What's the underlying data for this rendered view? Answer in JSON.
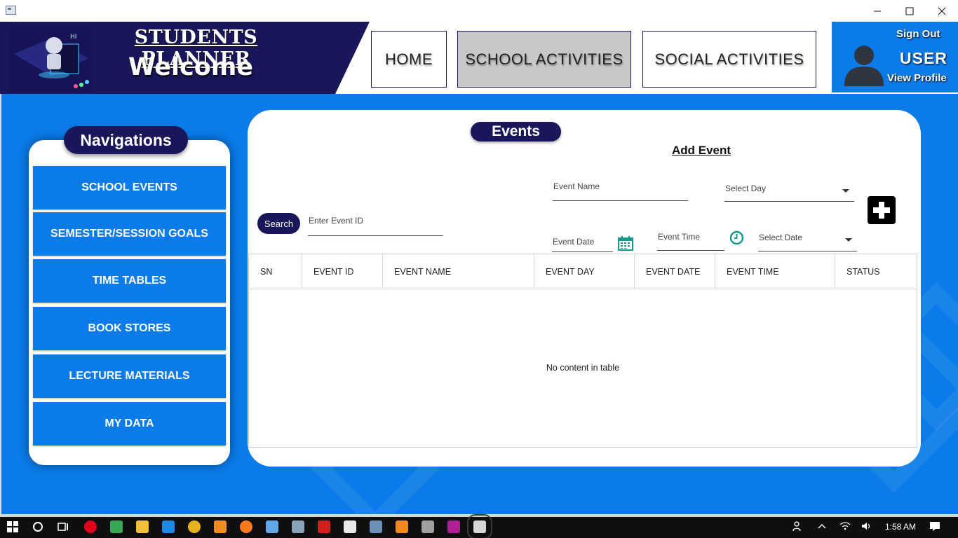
{
  "header": {
    "title": "STUDENTS PLANNER",
    "welcome": "Welcome",
    "nav": [
      "HOME",
      "SCHOOL ACTIVITIES",
      "SOCIAL ACTIVITIES"
    ],
    "profile": {
      "sign_out": "Sign Out",
      "user": "USER",
      "view_profile": "View Profile"
    }
  },
  "sidebar": {
    "title": "Navigations",
    "items": [
      "SCHOOL EVENTS",
      "SEMESTER/SESSION GOALS",
      "TIME TABLES",
      "BOOK STORES",
      "LECTURE MATERIALS",
      "MY DATA"
    ]
  },
  "events": {
    "title": "Events",
    "add_event": "Add Event",
    "fields": {
      "event_name": "Event Name",
      "select_day": "Select Day",
      "event_date": "Event Date",
      "event_time": "Event Time",
      "select_date": "Select Date",
      "event_id": "Enter Event ID"
    },
    "search_label": "Search",
    "table": {
      "columns": [
        "SN",
        "EVENT ID",
        "EVENT NAME",
        "EVENT DAY",
        "EVENT DATE",
        "EVENT TIME",
        "STATUS"
      ],
      "empty_text": "No content in table"
    }
  },
  "taskbar": {
    "time": "1:58 AM"
  },
  "colors": {
    "navy": "#191659",
    "blue": "#0a7be8",
    "selected_tab": "#c8c8c8"
  }
}
